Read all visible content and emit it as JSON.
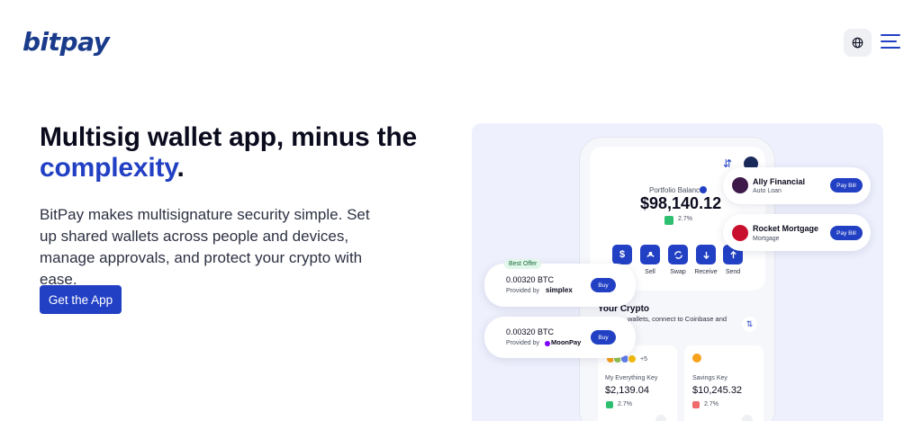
{
  "header": {
    "logo": "bitpay",
    "globe_icon": "globe-icon",
    "menu_icon": "hamburger-menu-icon"
  },
  "hero": {
    "headline_line1": "Multisig wallet app, minus the",
    "headline_accent": "complexity",
    "headline_period": ".",
    "body": "BitPay makes multisignature security simple. Set up shared wallets across people and devices, manage approvals, and protect your crypto with ease.",
    "cta_label": "Get the App"
  },
  "phone": {
    "portfolio_label": "Portfolio Balance",
    "portfolio_value": "$98,140.12",
    "portfolio_change": "2.7%",
    "actions": [
      {
        "label": "",
        "icon": "$"
      },
      {
        "label": "Sell",
        "icon": "sell-icon"
      },
      {
        "label": "Swap",
        "icon": "swap-icon"
      },
      {
        "label": "Receive",
        "icon": "receive-icon"
      },
      {
        "label": "Send",
        "icon": "send-icon"
      }
    ],
    "your_crypto_title": "Your Crypto",
    "your_crypto_sub": "wallets, connect to Coinbase and",
    "coins_more": "+5",
    "keys": [
      {
        "name": "My Everything Key",
        "value": "$2,139.04",
        "change": "2.7%"
      },
      {
        "name": "Savings Key",
        "value": "$10,245.32",
        "change": "2.7%"
      }
    ]
  },
  "bills": [
    {
      "title": "Ally Financial",
      "sub": "Auto Loan",
      "button": "Pay Bill"
    },
    {
      "title": "Rocket Mortgage",
      "sub": "Mortgage",
      "button": "Pay Bill"
    }
  ],
  "offers": {
    "badge": "Best Offer",
    "items": [
      {
        "amount": "0.00320 BTC",
        "provided_by": "Provided by",
        "provider": "simplex",
        "button": "Buy"
      },
      {
        "amount": "0.00320 BTC",
        "provided_by": "Provided by",
        "provider": "MoonPay",
        "button": "Buy"
      }
    ]
  },
  "colors": {
    "brand_blue": "#2240c4",
    "logo_blue": "#1a3b8b",
    "panel_bg": "#eef0fd",
    "positive_green": "#2fbf71"
  }
}
